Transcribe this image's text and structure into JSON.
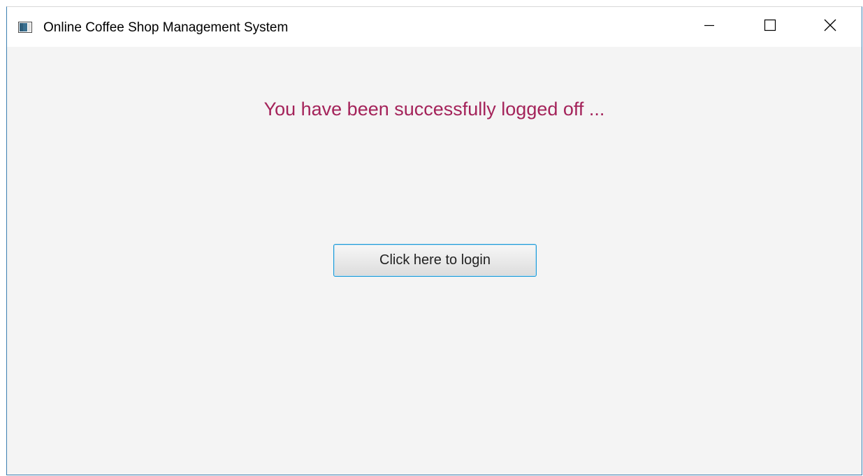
{
  "window": {
    "title": "Online Coffee Shop Management System",
    "icon": "java-app-icon",
    "controls": {
      "minimize_icon": "minimize-icon",
      "maximize_icon": "maximize-icon",
      "close_icon": "close-icon"
    }
  },
  "content": {
    "message": "You have been successfully logged off ...",
    "login_button_label": "Click here to login"
  },
  "colors": {
    "message": "#a4235a",
    "button_border": "#1b9bd8",
    "background": "#f4f4f4",
    "window_border": "#3c7fb1"
  }
}
